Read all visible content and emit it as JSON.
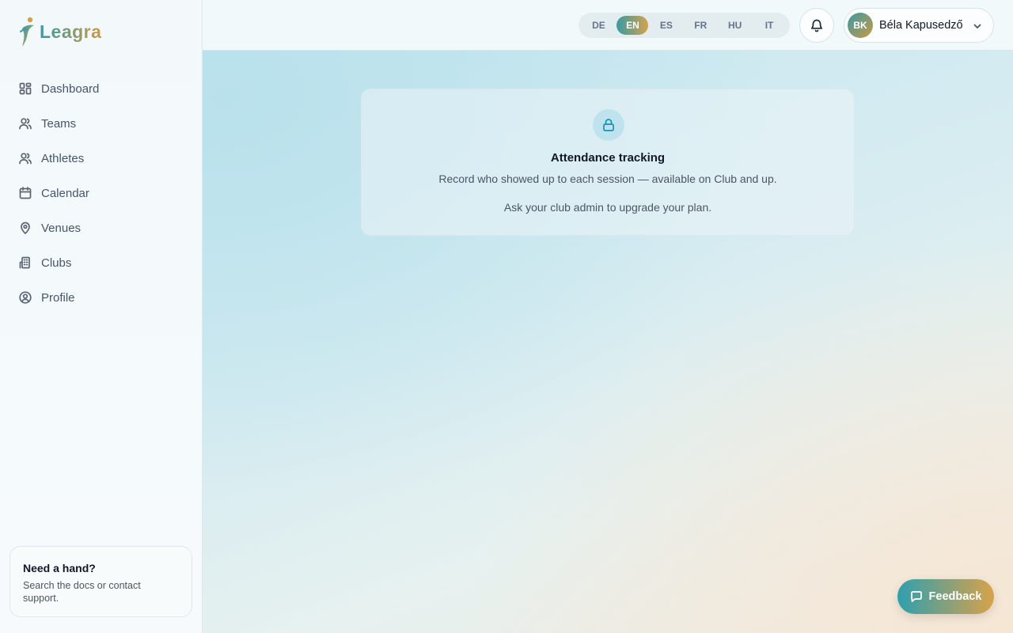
{
  "brand": {
    "name": "Leagra"
  },
  "sidebar": {
    "items": [
      {
        "label": "Dashboard",
        "icon": "dashboard-icon"
      },
      {
        "label": "Teams",
        "icon": "teams-icon"
      },
      {
        "label": "Athletes",
        "icon": "athletes-icon"
      },
      {
        "label": "Calendar",
        "icon": "calendar-icon"
      },
      {
        "label": "Venues",
        "icon": "map-pin-icon"
      },
      {
        "label": "Clubs",
        "icon": "building-icon"
      },
      {
        "label": "Profile",
        "icon": "user-circle-icon"
      }
    ],
    "help": {
      "title": "Need a hand?",
      "text": "Search the docs or contact support."
    }
  },
  "header": {
    "languages": [
      "DE",
      "EN",
      "ES",
      "FR",
      "HU",
      "IT"
    ],
    "active_language": "EN",
    "user": {
      "initials": "BK",
      "name": "Béla Kapusedző"
    }
  },
  "main": {
    "locked_feature": {
      "title": "Attendance tracking",
      "description": "Record who showed up to each session — available on Club and up.",
      "note": "Ask your club admin to upgrade your plan."
    }
  },
  "feedback": {
    "label": "Feedback"
  },
  "colors": {
    "brand_teal": "#3a9aa4",
    "brand_gold": "#c99a45",
    "lock_accent": "#1595b5"
  }
}
